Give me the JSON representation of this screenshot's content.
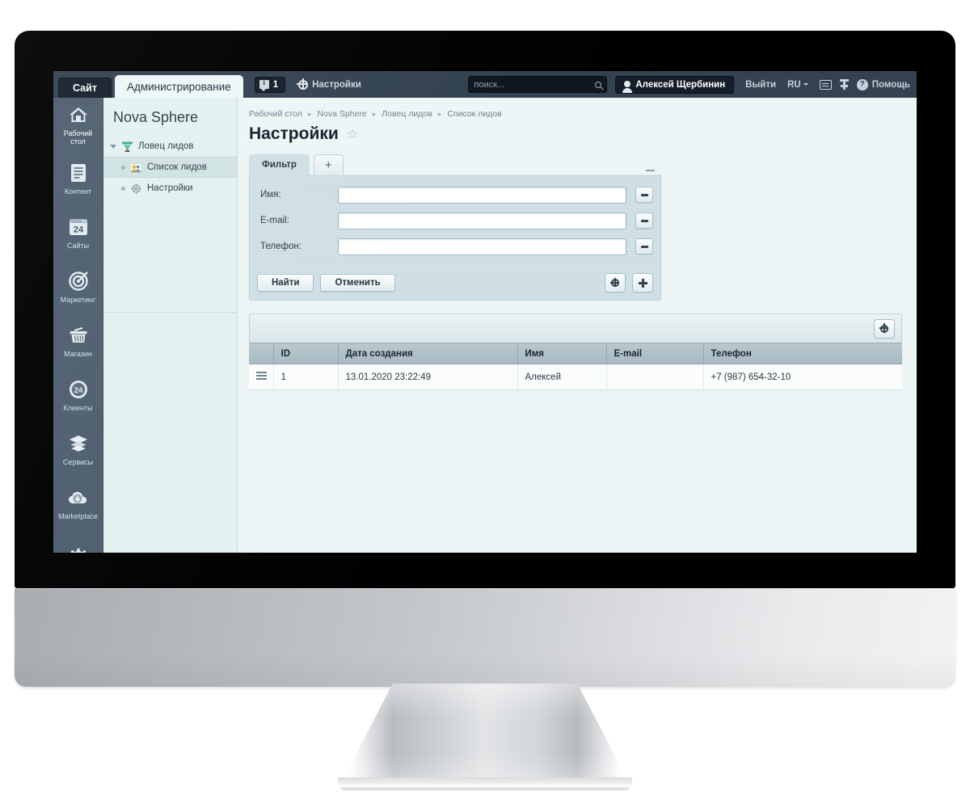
{
  "topbar": {
    "site_tab": "Сайт",
    "admin_tab": "Администрирование",
    "messages_count": "1",
    "settings_label": "Настройки",
    "search_placeholder": "поиск...",
    "search_value": "",
    "user_name": "Алексей Щербинин",
    "logout_label": "Выйти",
    "lang_label": "RU",
    "help_label": "Помощь"
  },
  "rail": {
    "items": [
      {
        "label": "Рабочий\nстол",
        "icon": "home-icon"
      },
      {
        "label": "Контент",
        "icon": "document-icon"
      },
      {
        "label": "Сайты",
        "icon": "sites-24-icon"
      },
      {
        "label": "Маркетинг",
        "icon": "target-icon"
      },
      {
        "label": "Магазин",
        "icon": "basket-icon"
      },
      {
        "label": "Клиенты",
        "icon": "clients-24-icon"
      },
      {
        "label": "Сервисы",
        "icon": "layers-icon"
      },
      {
        "label": "Marketplace",
        "icon": "cloud-download-icon"
      },
      {
        "label": "",
        "icon": "gear-icon"
      }
    ]
  },
  "subnav": {
    "title": "Nova Sphere",
    "tree": [
      {
        "label": "Ловец лидов",
        "level": 0,
        "selected": false,
        "icon": "funnel-icon"
      },
      {
        "label": "Список лидов",
        "level": 1,
        "selected": true,
        "icon": "leads-icon"
      },
      {
        "label": "Настройки",
        "level": 1,
        "selected": false,
        "icon": "gear-icon"
      }
    ]
  },
  "breadcrumb": {
    "items": [
      "Рабочий стол",
      "Nova Sphere",
      "Ловец лидов",
      "Список лидов"
    ],
    "separator": "▸"
  },
  "page": {
    "title": "Настройки",
    "favorite_star": "☆"
  },
  "filter": {
    "tab_label": "Фильтр",
    "add_tab_label": "+",
    "collapse_label": "−",
    "fields": [
      {
        "label": "Имя:",
        "value": "",
        "placeholder": "",
        "remove_label": "−"
      },
      {
        "label": "E-mail:",
        "value": "",
        "placeholder": "",
        "remove_label": "−"
      },
      {
        "label": "Телефон:",
        "value": "",
        "placeholder": "",
        "remove_label": "−"
      }
    ],
    "search_button": "Найти",
    "cancel_button": "Отменить",
    "settings_button": "gear-icon",
    "add_button": "+"
  },
  "grid": {
    "toolbar_settings": "gear-icon",
    "columns": [
      "",
      "ID",
      "Дата создания",
      "Имя",
      "E-mail",
      "Телефон"
    ],
    "rows": [
      {
        "handle": "≡",
        "id": "1",
        "created": "13.01.2020 23:22:49",
        "name": "Алексей",
        "email": "",
        "phone": "+7 (987) 654-32-10"
      }
    ]
  },
  "colors": {
    "topbar": "#31404f",
    "rail": "#4c5d6e",
    "subnav": "#e3f1f1",
    "content": "#e9f4f4",
    "filter_body": "#c9dce3",
    "grid_header": "#b0c1c8",
    "accent_dark": "#151e2a"
  }
}
